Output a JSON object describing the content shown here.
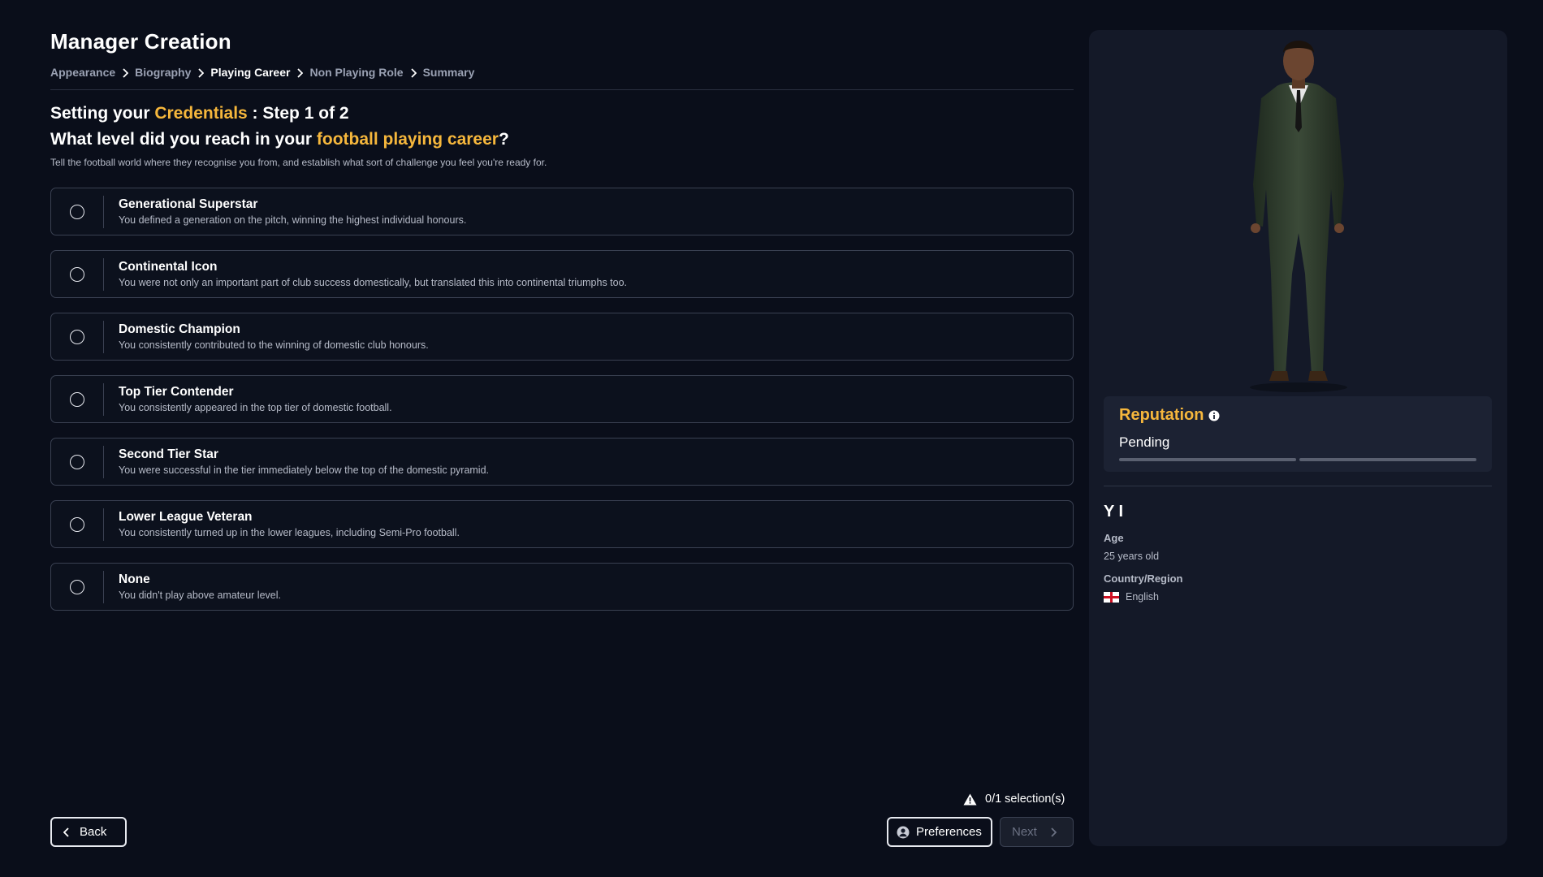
{
  "header": {
    "title": "Manager Creation",
    "breadcrumb": [
      "Appearance",
      "Biography",
      "Playing Career",
      "Non Playing Role",
      "Summary"
    ],
    "active_crumb": "Playing Career"
  },
  "step": {
    "line1_prefix": "Setting your ",
    "line1_accent": "Credentials",
    "line1_suffix": " : Step 1 of 2",
    "line2_prefix": "What level did you reach in your ",
    "line2_accent": "football playing career",
    "line2_suffix": "?",
    "description": "Tell the football world where they recognise you from, and establish what sort of challenge you feel you're ready for."
  },
  "options": [
    {
      "title": "Generational Superstar",
      "desc": "You defined a generation on the pitch, winning the highest individual honours."
    },
    {
      "title": "Continental Icon",
      "desc": "You were not only an important part of club success domestically, but translated this into continental triumphs too."
    },
    {
      "title": "Domestic Champion",
      "desc": "You consistently contributed to the winning of domestic club honours."
    },
    {
      "title": "Top Tier Contender",
      "desc": "You consistently appeared in the top tier of domestic football."
    },
    {
      "title": "Second Tier Star",
      "desc": "You were successful in the tier immediately below the top of the domestic pyramid."
    },
    {
      "title": "Lower League Veteran",
      "desc": "You consistently turned up in the lower leagues, including Semi-Pro football."
    },
    {
      "title": "None",
      "desc": "You didn't play above amateur level."
    }
  ],
  "footer": {
    "selection_status": "0/1 selection(s)",
    "back_label": "Back",
    "preferences_label": "Preferences",
    "next_label": "Next"
  },
  "profile": {
    "reputation_title": "Reputation",
    "reputation_status": "Pending",
    "name": "Y I",
    "age_label": "Age",
    "age_value": "25 years old",
    "country_label": "Country/Region",
    "country_value": "English"
  },
  "colors": {
    "background": "#0a0e1a",
    "accent": "#f6b73c",
    "panel": "#141928"
  }
}
